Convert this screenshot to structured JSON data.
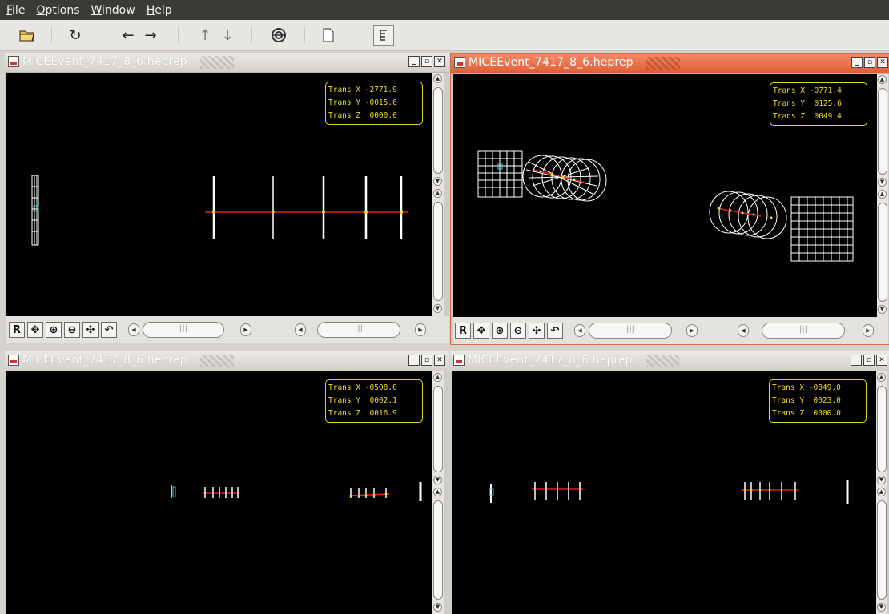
{
  "menu": {
    "items": [
      "File",
      "Options",
      "Window",
      "Help"
    ]
  },
  "toolbar": {
    "icons": [
      "open-folder-icon",
      "reload-icon",
      "back-arrow-icon",
      "forward-arrow-icon",
      "up-arrow-icon",
      "down-arrow-icon",
      "detector-icon",
      "new-page-icon",
      "tree-view-icon"
    ]
  },
  "panes": [
    {
      "title": "MICEEvent_7417_8_6.heprep",
      "active": false,
      "trans_x": "Trans X -2771.9",
      "trans_y": "Trans Y -0015.6",
      "trans_z": "Trans Z  0000.0"
    },
    {
      "title": "MICEEvent_7417_8_6.heprep",
      "active": true,
      "trans_x": "Trans X -0771.4",
      "trans_y": "Trans Y  0125.6",
      "trans_z": "Trans Z  0049.4"
    },
    {
      "title": "MICEEvent_7417_8_6.heprep",
      "active": false,
      "trans_x": "Trans X -0508.0",
      "trans_y": "Trans Y  0002.1",
      "trans_z": "Trans Z  0016.9"
    },
    {
      "title": "MICEEvent_7417_8_6.heprep",
      "active": false,
      "trans_x": "Trans X -0849.0",
      "trans_y": "Trans Y  0023.0",
      "trans_z": "Trans Z  0000.0"
    }
  ],
  "nav": {
    "reset_label": "R"
  },
  "colors": {
    "track": "#e02020",
    "hit": "#f0e020",
    "detector": "#ffffff",
    "target": "#30d0e0",
    "info_border": "#e8d21a",
    "active_frame": "#e05f36"
  }
}
